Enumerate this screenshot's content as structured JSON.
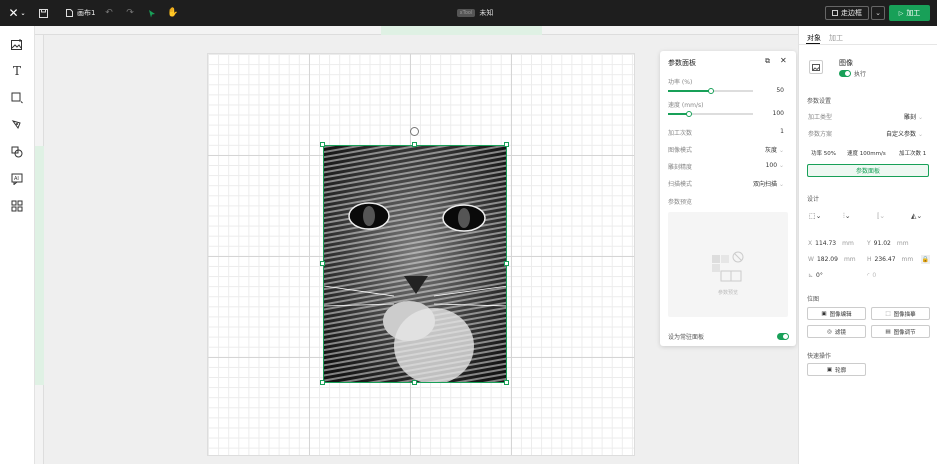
{
  "topbar": {
    "logo_icon": "x-logo-icon",
    "file_name": "画布1",
    "device_tag": "xTool",
    "device_name": "未知",
    "frame_label": "走边框",
    "process_label": "加工"
  },
  "left_tools": [
    "image-icon",
    "text-icon",
    "shape-icon",
    "pen-icon",
    "layers-icon",
    "ai-icon",
    "apps-icon"
  ],
  "param_panel": {
    "title": "参数面板",
    "power_label": "功率 (%)",
    "power_value": "50",
    "power_fraction": 0.5,
    "speed_label": "速度 (mm/s)",
    "speed_value": "100",
    "speed_fraction": 0.25,
    "passes_label": "加工次数",
    "passes_value": "1",
    "image_mode_label": "图像模式",
    "image_mode_value": "灰度",
    "lpi_label": "雕刻精度",
    "lpi_value": "100",
    "scan_label": "扫描模式",
    "scan_value": "双向扫描",
    "preview_label": "参数预览",
    "preview_placeholder": "参数预览",
    "default_label": "设为常驻面板",
    "default_on": true
  },
  "right_panel": {
    "tabs": [
      "对象",
      "加工"
    ],
    "object_name": "图像",
    "object_status": "执行",
    "params_title": "参数设置",
    "process_type_label": "加工类型",
    "process_type_value": "雕刻",
    "param_scheme_label": "参数方案",
    "param_scheme_value": "自定义参数",
    "chip_power": "功率 50%",
    "chip_speed": "速度 100mm/s",
    "chip_passes": "加工次数 1",
    "param_panel_btn": "参数面板",
    "design_title": "设计",
    "x_label": "X",
    "x_value": "114.73",
    "y_label": "Y",
    "y_value": "91.02",
    "w_label": "W",
    "w_value": "182.09",
    "h_label": "H",
    "h_value": "236.47",
    "unit": "mm",
    "rotate_value": "0°",
    "corner_value": "0",
    "bitmap_title": "位图",
    "btn_edit": "图像编辑",
    "btn_trace": "图像描摹",
    "btn_filter": "滤镜",
    "btn_adjust": "图像调节",
    "quick_title": "快速操作",
    "btn_outline": "轮廓"
  }
}
